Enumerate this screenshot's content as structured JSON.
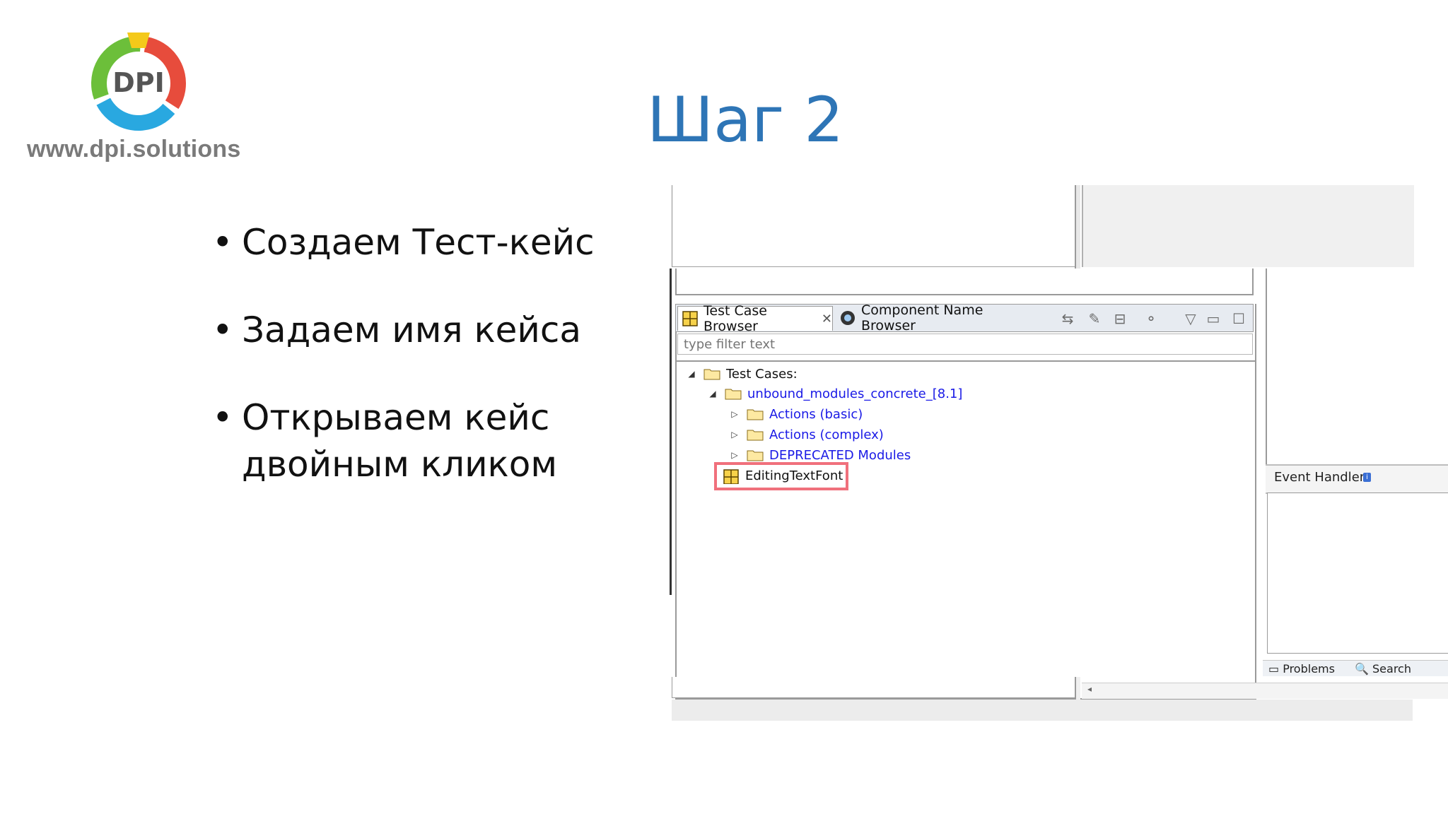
{
  "logo": {
    "brand": "DPI",
    "url": "www.dpi.solutions"
  },
  "title": "Шаг 2",
  "bullets": [
    "Создаем Тест-кейс",
    "Задаем имя кейса",
    "Открываем кейс",
    "двойным кликом"
  ],
  "ide": {
    "tabs": [
      {
        "label": "Test Case Browser",
        "icon": "test-case-grid-icon",
        "active": true
      },
      {
        "label": "Component Name Browser",
        "icon": "component-camera-icon",
        "active": false
      }
    ],
    "filter_placeholder": "type filter text",
    "tree": {
      "root": "Test Cases:",
      "module": "unbound_modules_concrete_[8.1]",
      "children": [
        "Actions (basic)",
        "Actions (complex)",
        "DEPRECATED Modules"
      ],
      "selected": "EditingTextFont"
    },
    "event_handler_label": "Event Handler:",
    "bottom_tabs": [
      "Problems",
      "Search"
    ]
  },
  "colors": {
    "title": "#2e75b6",
    "highlight": "#f0707c",
    "link": "#1a1ae6"
  }
}
